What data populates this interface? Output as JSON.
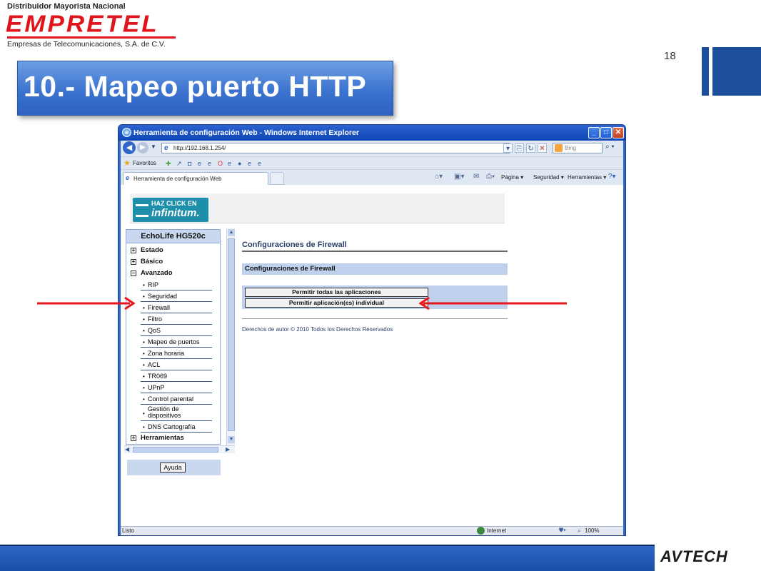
{
  "slide": {
    "logo_tagline": "Distribuidor Mayorista Nacional",
    "logo_brand": "EMPRETEL",
    "logo_subtitle": "Empresas de Telecomunicaciones, S.A. de C.V.",
    "page_number": "18",
    "title": "10.- Mapeo puerto HTTP",
    "bottom_brand": "AVTECH",
    "accent_color": "#1b4f9c"
  },
  "browser": {
    "title": "Herramienta de configuración Web - Windows Internet Explorer",
    "window_buttons": {
      "minimize": "_",
      "maximize": "□",
      "close": "✕"
    },
    "address": "http://192.168.1.254/",
    "search_placeholder": "Bing",
    "favorites_label": "Favoritos",
    "tab_label": "Herramienta de configuración Web",
    "command_bar": {
      "page": "Página ▾",
      "security": "Seguridad ▾",
      "tools": "Herramientas ▾"
    },
    "status": {
      "left": "Listo",
      "zone": "Internet",
      "zoom": "100%"
    }
  },
  "router_page": {
    "banner": {
      "line1": "HAZ CLICK EN",
      "line2": "infinitum."
    },
    "device_name": "EchoLife HG520c",
    "nav": {
      "top_items": [
        {
          "label": "Estado",
          "expander": "+"
        },
        {
          "label": "Básico",
          "expander": "+"
        },
        {
          "label": "Avanzado",
          "expander": "−"
        }
      ],
      "advanced_items": [
        "RIP",
        "Seguridad",
        "Firewall",
        "Filtro",
        "QoS",
        "Mapeo de puertos",
        "Zona horaria",
        "ACL",
        "TR069",
        "UPnP",
        "Control parental",
        "Gestión de dispositivos",
        "DNS Cartografía"
      ],
      "tools": {
        "label": "Herramientas",
        "expander": "+"
      },
      "help_button": "Ayuda"
    },
    "main": {
      "title": "Configuraciones de Firewall",
      "panel_title": "Configuraciones de Firewall",
      "button_all": "Permitir todas las aplicaciones",
      "button_individual": "Permitir aplicación(es) individual",
      "footer": "Derechos de autor © 2010 Todos los Derechos Reservados"
    }
  },
  "annotations": {
    "arrow_color": "#e8151b"
  }
}
